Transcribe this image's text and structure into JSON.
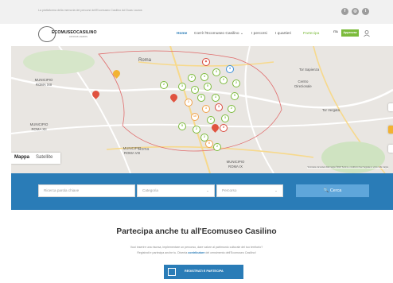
{
  "topbar": {
    "tagline": "La piattaforma della memoria dei percorsi dell'Ecomuseo Casilino Ad Duas Lauros",
    "social": [
      {
        "icon": "facebook-icon",
        "glyph": "f"
      },
      {
        "icon": "instagram-icon",
        "glyph": "◎"
      },
      {
        "icon": "twitter-icon",
        "glyph": "t"
      }
    ]
  },
  "header": {
    "logo": {
      "name": "ECOMUSEOCASILINO",
      "sub": "AD DUAS LAUROS"
    },
    "nav": [
      "Home",
      "Cos'è l'Ecomuseo Casilino ⌄",
      "I percorsi",
      "I quartieri",
      "Partecipa"
    ],
    "lang": "ITA",
    "approve_label": "Approvaz"
  },
  "map": {
    "labels": [
      "Roma",
      "MUNICIPIO ROMA XIII",
      "Tor Sapienza",
      "Centro Direzionale",
      "MUNICIPIO ROMA XII",
      "Tor Vergata",
      "MUNICIPIO ROMA VIII",
      "Roma",
      "MUNICIPIO ROMA IX"
    ],
    "type_map": "Mappa",
    "type_satellite": "Satellite",
    "attribution": "Scorciatoie da tastiera   Dati mappa ©2021   Termini e condizioni d'uso   Segnala un errore nella mappa",
    "markers": [
      {
        "style": "green",
        "label": "2"
      },
      {
        "style": "red",
        "label": "◈"
      },
      {
        "style": "green",
        "label": "3"
      },
      {
        "style": "blue",
        "label": "3"
      },
      {
        "style": "green",
        "label": "2"
      },
      {
        "style": "green",
        "label": "4"
      },
      {
        "style": "green",
        "label": "3"
      },
      {
        "style": "green",
        "label": "4"
      },
      {
        "style": "green",
        "label": "5"
      },
      {
        "style": "green",
        "label": "2"
      },
      {
        "style": "green",
        "label": "2"
      },
      {
        "style": "green",
        "label": "5"
      },
      {
        "style": "green",
        "label": "3"
      },
      {
        "style": "orange",
        "label": "2"
      },
      {
        "style": "orange",
        "label": "3"
      },
      {
        "style": "red",
        "label": "3"
      },
      {
        "style": "orange",
        "label": "10"
      },
      {
        "style": "green",
        "label": "2"
      },
      {
        "style": "green",
        "label": "5"
      },
      {
        "style": "green",
        "label": "2"
      },
      {
        "style": "green",
        "label": "3"
      },
      {
        "style": "green",
        "label": "5"
      },
      {
        "style": "green",
        "label": "2"
      },
      {
        "style": "red",
        "label": "3"
      },
      {
        "style": "green",
        "label": "2"
      },
      {
        "style": "orange",
        "label": "6"
      },
      {
        "style": "green",
        "label": "2"
      }
    ]
  },
  "search": {
    "keyword_placeholder": "Ricerca parola chiave",
    "category_placeholder": "Categoria",
    "category_caret": "⌄",
    "percorso_placeholder": "Percorso",
    "percorso_caret": "⌄",
    "button_label": "🔍  Cerca"
  },
  "partecipa": {
    "title": "Partecipa anche tu all'Ecomuseo Casilino",
    "line1": "Vuoi inserire una risorsa, implementare un percorso, dare valore al patrimonio culturale del tuo territorio?",
    "line2_pre": "Registrati e partecipa anche tu. Diventa ",
    "line2_bold": "contributore",
    "line2_post": " del censimento dell'Ecomuseo Casilino!",
    "cta_label": "REGISTRATI E PARTECIPA"
  },
  "colors": {
    "brand_blue": "#2a7cb7",
    "green": "#7cbb3c",
    "orange": "#f0a24b",
    "red": "#d9493d"
  }
}
